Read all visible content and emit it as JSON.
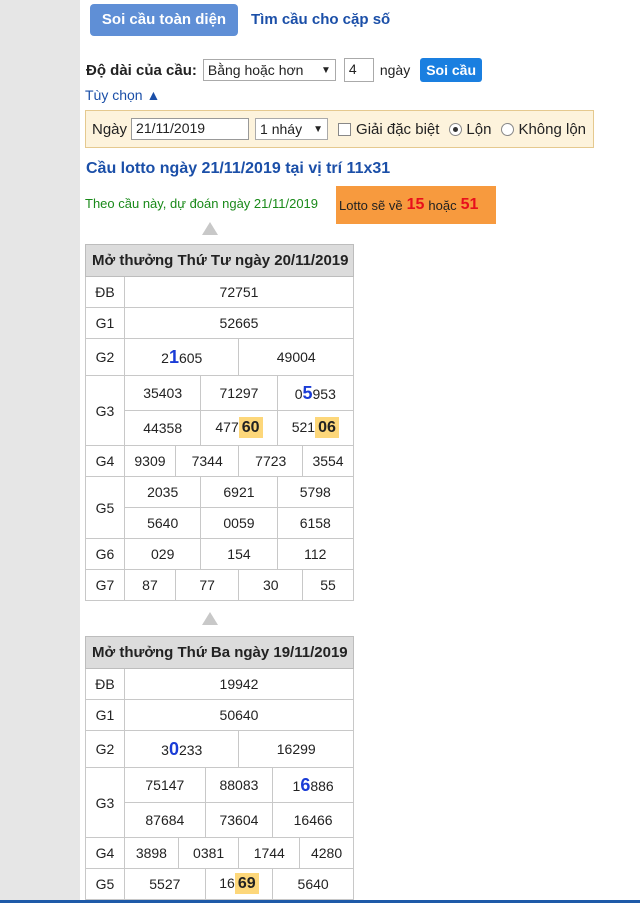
{
  "tabs": {
    "active": "Soi cầu toàn diện",
    "other": "Tìm cầu cho cặp số"
  },
  "form": {
    "length_label": "Độ dài của cầu:",
    "length_select": "Bằng hoặc hơn",
    "length_value": "4",
    "length_unit": "ngày",
    "submit_label": "Soi cầu",
    "options_link": "Tùy chọn ▲",
    "date_label": "Ngày",
    "date_value": "21/11/2019",
    "step_select": "1 nháy",
    "special_label": "Giải đặc biệt",
    "reversed_label": "Lộn",
    "not_reversed_label": "Không lộn"
  },
  "heading": "Cầu lotto ngày 21/11/2019 tại vị trí 11x31",
  "prediction": {
    "text": "Theo cầu này, dự đoán ngày 21/11/2019",
    "box_prefix": "Lotto sẽ về",
    "first": "15",
    "middle": "hoặc",
    "second": "51"
  },
  "draws": [
    {
      "title": "Mở thưởng Thứ Tư ngày 20/11/2019",
      "db": "72751",
      "g1": "52665",
      "g2": [
        {
          "a": "2",
          "b": "1",
          "c": "605"
        },
        "49004"
      ],
      "g3": [
        "35403",
        "71297",
        {
          "a": "0",
          "b": "5",
          "c": "953"
        },
        {
          "a": "477",
          "hl": "60"
        },
        "44358",
        {
          "a": "521",
          "hl": "06"
        }
      ],
      "g4": [
        "9309",
        "7344",
        "7723",
        "3554"
      ],
      "g5": [
        "2035",
        "6921",
        "5798",
        "5640",
        "0059",
        "6158"
      ],
      "g6": [
        "029",
        "154",
        "112"
      ],
      "g7": [
        "87",
        "77",
        "30",
        "55"
      ]
    },
    {
      "title": "Mở thưởng Thứ Ba ngày 19/11/2019",
      "db": "19942",
      "g1": "50640",
      "g2": [
        {
          "a": "3",
          "b": "0",
          "c": "233"
        },
        "16299"
      ],
      "g3": [
        "75147",
        "88083",
        {
          "a": "1",
          "b": "6",
          "c": "886"
        },
        "87684",
        "73604",
        "16466"
      ],
      "g4": [
        "3898",
        "0381",
        "1744",
        "4280"
      ],
      "g5": [
        "5527",
        {
          "a": "16",
          "hl": "69"
        },
        "5640"
      ]
    }
  ],
  "labels": {
    "db": "ĐB",
    "g1": "G1",
    "g2": "G2",
    "g3": "G3",
    "g4": "G4",
    "g5": "G5",
    "g6": "G6",
    "g7": "G7"
  }
}
